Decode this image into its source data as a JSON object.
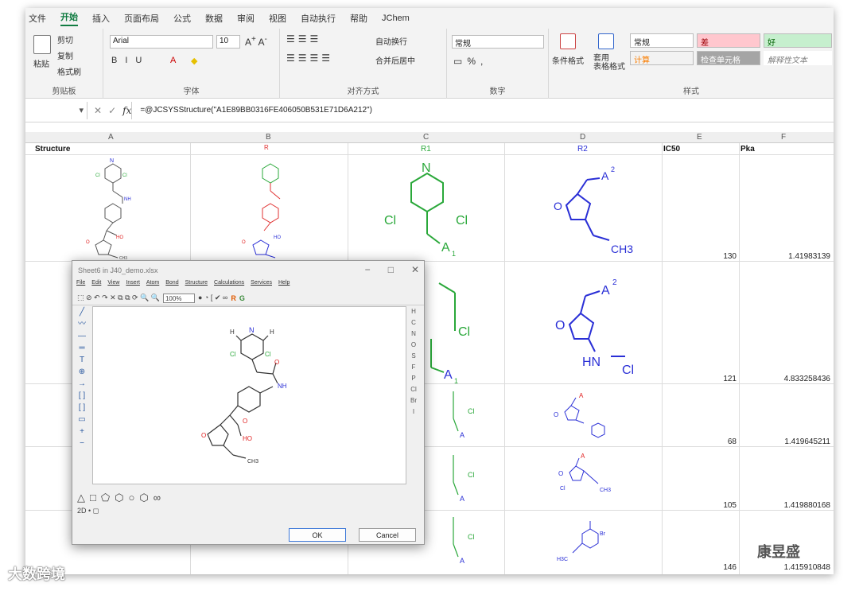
{
  "menu": [
    "文件",
    "开始",
    "插入",
    "页面布局",
    "公式",
    "数据",
    "审阅",
    "视图",
    "自动执行",
    "帮助",
    "JChem"
  ],
  "ribbon": {
    "clipboard": {
      "paste": "粘贴",
      "cut": "剪切",
      "copy": "复制",
      "format_painter": "格式刷",
      "label": "剪贴板"
    },
    "font": {
      "name": "Arial",
      "size": "10",
      "label": "字体"
    },
    "alignment": {
      "wrap": "自动换行",
      "merge": "合并后居中",
      "label": "对齐方式"
    },
    "number": {
      "format": "常规",
      "label": "数字"
    },
    "styles": {
      "conditional": "条件格式",
      "table": "套用\n表格格式",
      "normal": "常规",
      "bad": "差",
      "good": "好",
      "calc": "计算",
      "check": "检查单元格",
      "explain": "解释性文本",
      "label": "样式"
    }
  },
  "formula_bar": {
    "formula": "=@JCSYSStructure(\"A1E89BB0316FE406050B531E71D6A212\")"
  },
  "columns": [
    "A",
    "B",
    "C",
    "D",
    "E",
    "F"
  ],
  "headers": {
    "a": "Structure",
    "c": "R1",
    "d": "R2",
    "e": "IC50",
    "f": "Pka"
  },
  "rows": [
    {
      "ic50": "130",
      "pka": "1.41983139"
    },
    {
      "ic50": "121",
      "pka": "4.833258436"
    },
    {
      "ic50": "68",
      "pka": "1.419645211"
    },
    {
      "ic50": "105",
      "pka": "1.419880168"
    },
    {
      "ic50": "146",
      "pka": "1.415910848"
    }
  ],
  "dialog": {
    "title": "Sheet6 in J40_demo.xlsx",
    "menu": [
      "File",
      "Edit",
      "View",
      "Insert",
      "Atom",
      "Bond",
      "Structure",
      "Calculations",
      "Services",
      "Help"
    ],
    "zoom": "100%",
    "ok": "OK",
    "cancel": "Cancel"
  },
  "watermarks": {
    "left": "大数跨境",
    "right": "康昱盛"
  },
  "colors": {
    "accent": "#107c41",
    "r1": "#2aa83a",
    "r2": "#2a2fd6",
    "atom_o": "#e02020"
  }
}
